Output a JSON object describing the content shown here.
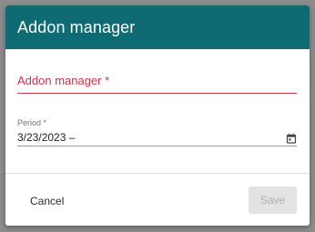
{
  "dialog": {
    "title": "Addon manager",
    "colors": {
      "header": "#0f6b73",
      "required_accent": "#c8384b",
      "backdrop": "#8c8c8c"
    }
  },
  "form": {
    "addon_field": {
      "label": "Addon manager *",
      "value": ""
    },
    "period_field": {
      "label": "Period *",
      "value": "3/23/2023 –",
      "icon": "calendar-icon"
    }
  },
  "footer": {
    "cancel_label": "Cancel",
    "save_label": "Save",
    "save_disabled": true
  }
}
